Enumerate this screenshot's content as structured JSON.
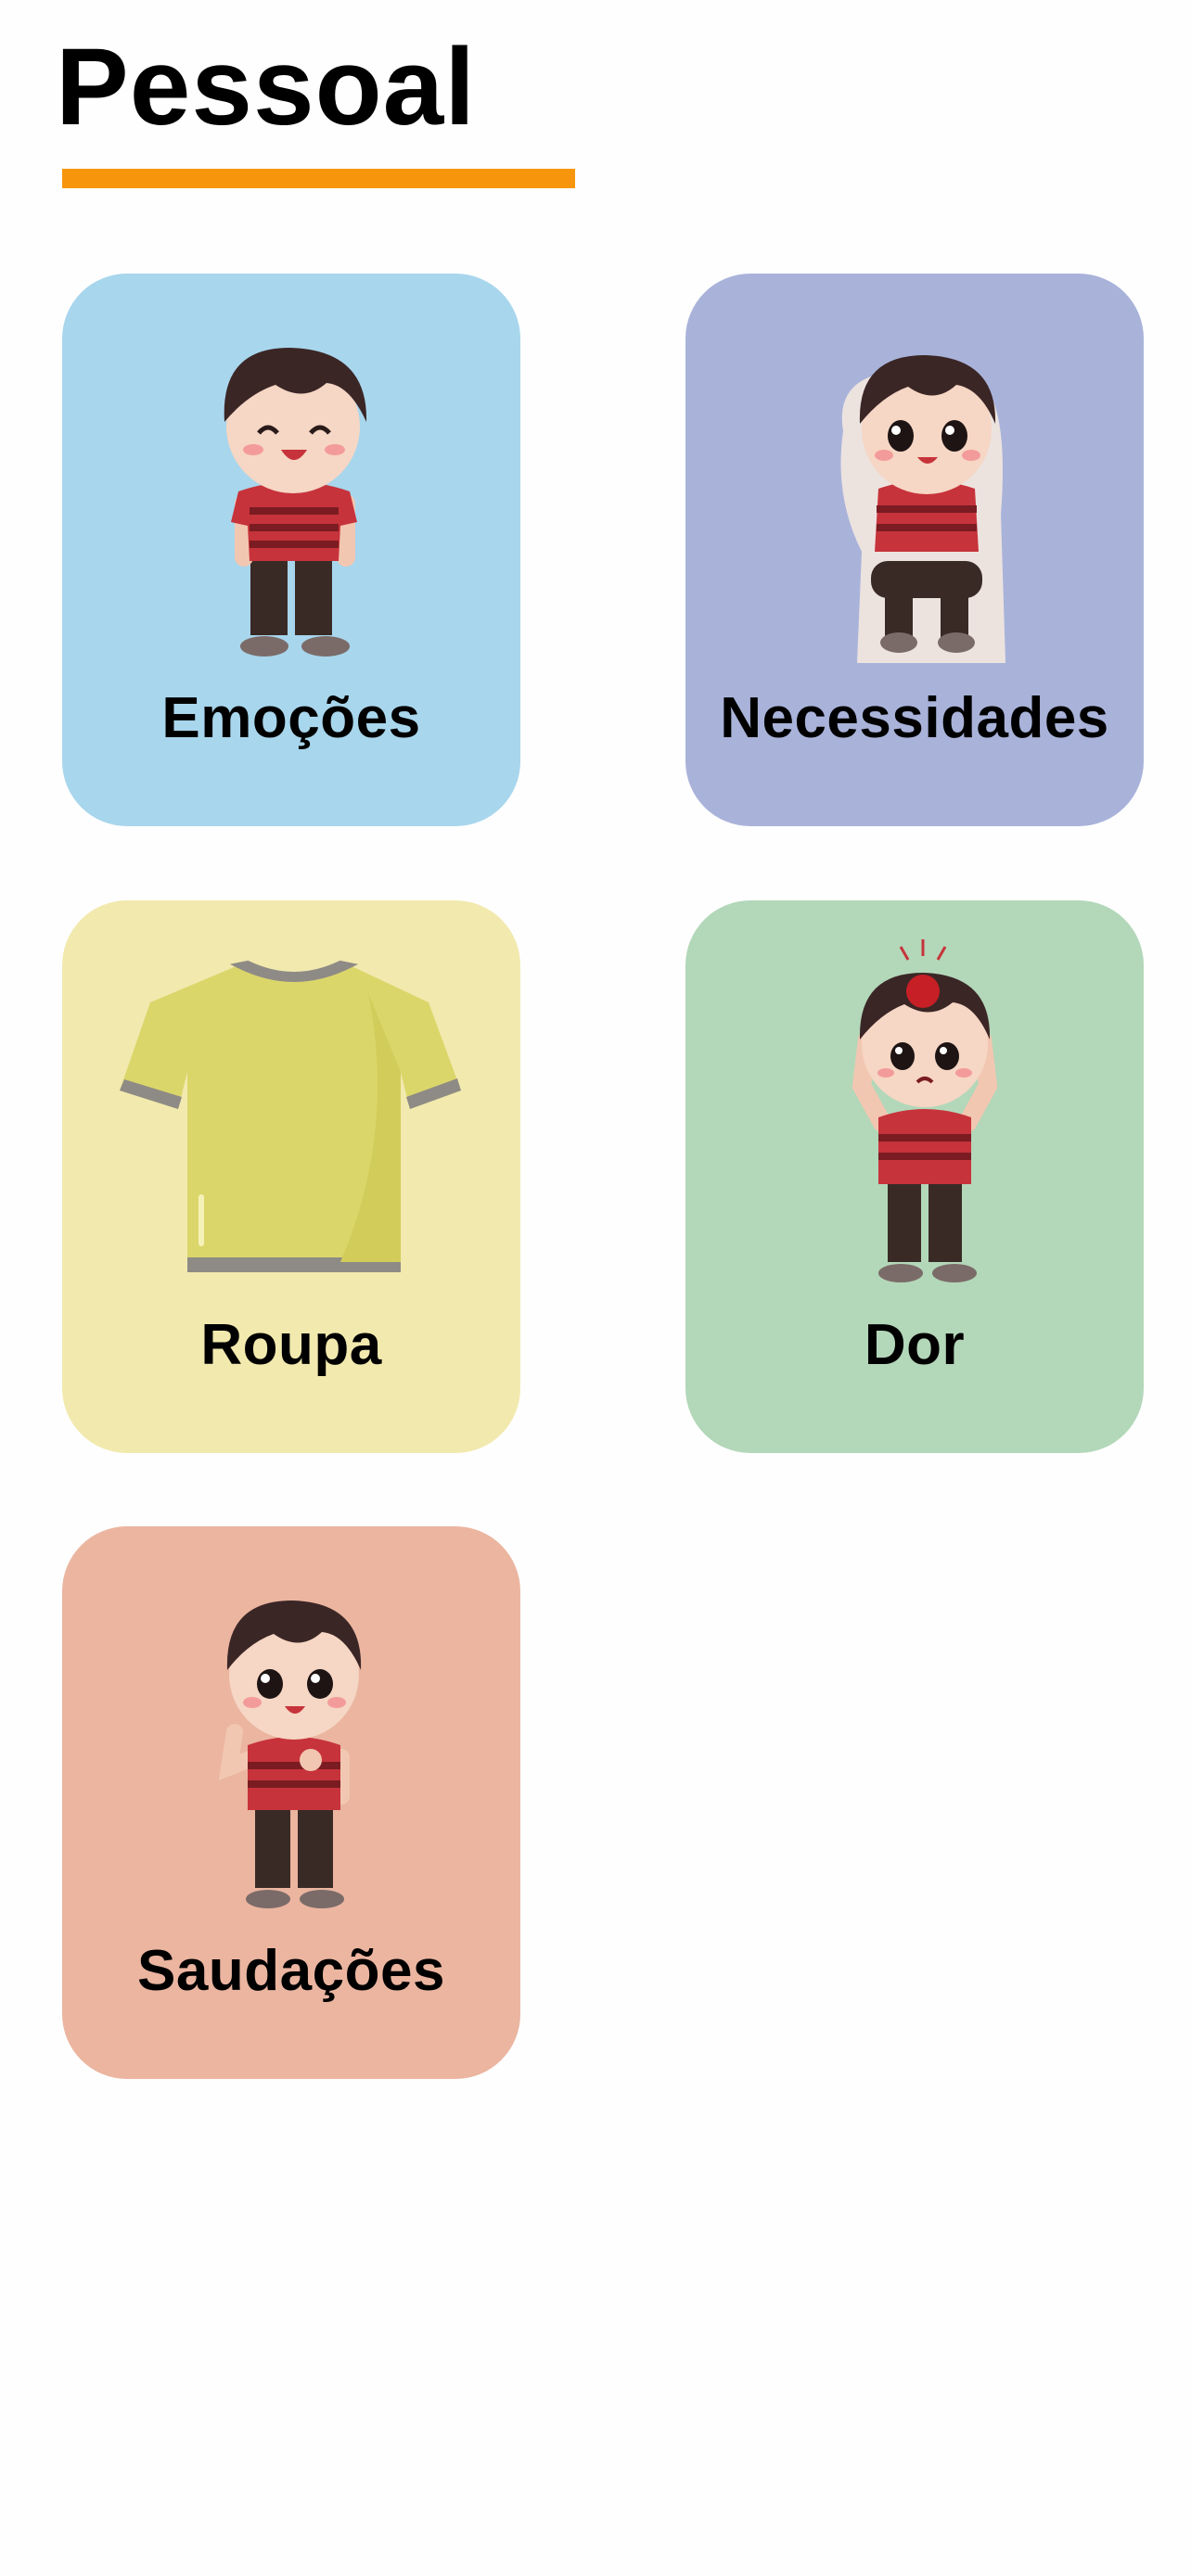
{
  "page": {
    "title": "Pessoal",
    "accent_color": "#f7960d"
  },
  "categories": [
    {
      "label": "Emoções",
      "icon": "happy-boy-icon",
      "color": "#a8d6ed"
    },
    {
      "label": "Necessidades",
      "icon": "boy-on-toilet-icon",
      "color": "#a9b3da"
    },
    {
      "label": "Roupa",
      "icon": "tshirt-icon",
      "color": "#f2e9ae"
    },
    {
      "label": "Dor",
      "icon": "boy-headache-icon",
      "color": "#b3d7b9"
    },
    {
      "label": "Saudações",
      "icon": "boy-greeting-icon",
      "color": "#ebb5a0"
    }
  ]
}
